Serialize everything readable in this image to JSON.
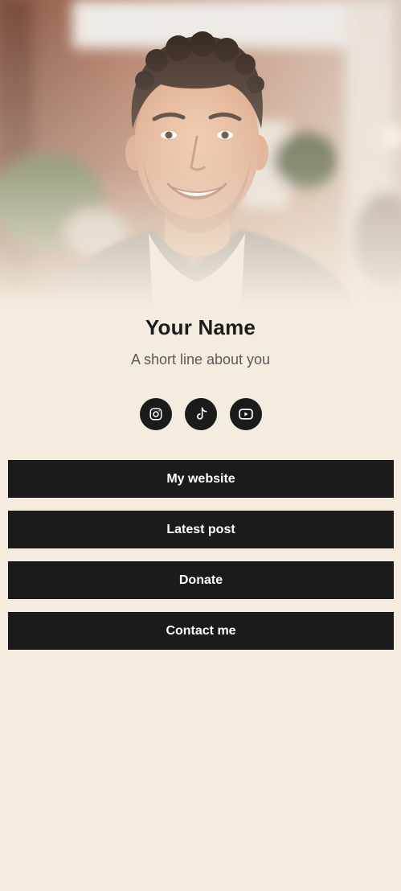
{
  "profile": {
    "name": "Your Name",
    "bio": "A short line about you",
    "photo_alt": "Profile photo"
  },
  "socials": [
    {
      "icon": "instagram-icon"
    },
    {
      "icon": "tiktok-icon"
    },
    {
      "icon": "youtube-icon"
    }
  ],
  "links": [
    {
      "label": "My website"
    },
    {
      "label": "Latest post"
    },
    {
      "label": "Donate"
    },
    {
      "label": "Contact me"
    }
  ],
  "colors": {
    "background": "#f4ecdf",
    "button": "#1b1b1b",
    "button_text": "#ffffff",
    "name_text": "#1c1c1c",
    "bio_text": "#5a5a5a"
  }
}
